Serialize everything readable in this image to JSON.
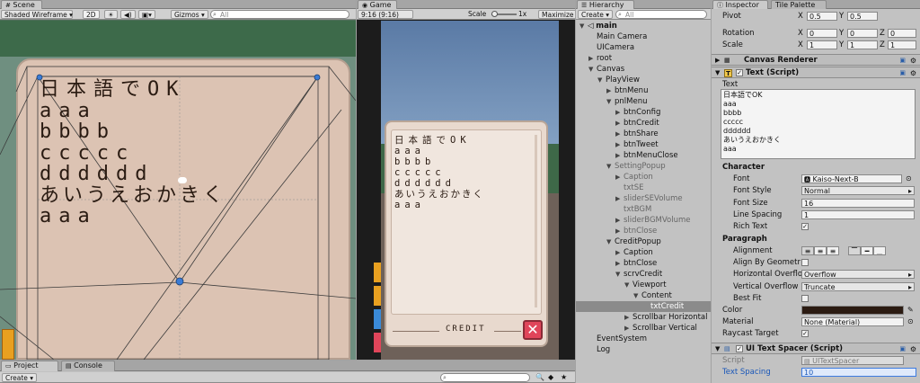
{
  "scene": {
    "tab": "Scene",
    "shading": "Shaded Wireframe",
    "mode_2d": "2D",
    "gizmos": "Gizmos",
    "search": "All",
    "text_lines": [
      "日本語でOK",
      "aaa",
      "bbbb",
      "ccccc",
      "dddddd",
      "あいうえおかきく",
      "aaa"
    ]
  },
  "game": {
    "tab": "Game",
    "resolution": "9:16 (9:16)",
    "scale_label": "Scale",
    "scale_value": "1x",
    "maximize": "Maximize",
    "popup_lines": [
      "日本語でOK",
      "aaa",
      "bbbb",
      "ccccc",
      "dddddd",
      "あいうえおかきく",
      "aaa"
    ],
    "credit_label": "CREDIT"
  },
  "hierarchy": {
    "tab": "Hierarchy",
    "create": "Create",
    "search": "All",
    "items": [
      {
        "label": "main",
        "expanded": true,
        "depth": 0,
        "scene": true
      },
      {
        "label": "Main Camera",
        "depth": 1
      },
      {
        "label": "UICamera",
        "depth": 1
      },
      {
        "label": "root",
        "depth": 1,
        "collapsed": true
      },
      {
        "label": "Canvas",
        "depth": 1,
        "expanded": true
      },
      {
        "label": "PlayView",
        "depth": 2,
        "expanded": true
      },
      {
        "label": "btnMenu",
        "depth": 3,
        "collapsed": true
      },
      {
        "label": "pnlMenu",
        "depth": 3,
        "expanded": true
      },
      {
        "label": "btnConfig",
        "depth": 4,
        "collapsed": true
      },
      {
        "label": "btnCredit",
        "depth": 4,
        "collapsed": true
      },
      {
        "label": "btnShare",
        "depth": 4,
        "collapsed": true
      },
      {
        "label": "btnTweet",
        "depth": 4,
        "collapsed": true
      },
      {
        "label": "btnMenuClose",
        "depth": 4,
        "collapsed": true
      },
      {
        "label": "SettingPopup",
        "depth": 3,
        "expanded": true,
        "dim": true
      },
      {
        "label": "Caption",
        "depth": 4,
        "collapsed": true,
        "dim": true
      },
      {
        "label": "txtSE",
        "depth": 4,
        "dim": true
      },
      {
        "label": "sliderSEVolume",
        "depth": 4,
        "collapsed": true,
        "dim": true
      },
      {
        "label": "txtBGM",
        "depth": 4,
        "dim": true
      },
      {
        "label": "sliderBGMVolume",
        "depth": 4,
        "collapsed": true,
        "dim": true
      },
      {
        "label": "btnClose",
        "depth": 4,
        "collapsed": true,
        "dim": true
      },
      {
        "label": "CreditPopup",
        "depth": 3,
        "expanded": true
      },
      {
        "label": "Caption",
        "depth": 4,
        "collapsed": true
      },
      {
        "label": "btnClose",
        "depth": 4,
        "collapsed": true
      },
      {
        "label": "scrvCredit",
        "depth": 4,
        "expanded": true
      },
      {
        "label": "Viewport",
        "depth": 5,
        "expanded": true
      },
      {
        "label": "Content",
        "depth": 6,
        "expanded": true
      },
      {
        "label": "txtCredit",
        "depth": 7,
        "selected": true
      },
      {
        "label": "Scrollbar Horizontal",
        "depth": 5,
        "collapsed": true
      },
      {
        "label": "Scrollbar Vertical",
        "depth": 5,
        "collapsed": true
      },
      {
        "label": "EventSystem",
        "depth": 1
      },
      {
        "label": "Log",
        "depth": 1
      }
    ]
  },
  "inspector": {
    "tab": "Inspector",
    "tab2": "Tile Palette",
    "pivot": {
      "label": "Pivot",
      "x": "0.5",
      "y": "0.5"
    },
    "rotation": {
      "label": "Rotation",
      "x": "0",
      "y": "0",
      "z": "0"
    },
    "scale": {
      "label": "Scale",
      "x": "1",
      "y": "1",
      "z": "1"
    },
    "canvas_renderer": "Canvas Renderer",
    "text_script": "Text (Script)",
    "text_label": "Text",
    "text_value": [
      "日本語でOK",
      "aaa",
      "bbbb",
      "ccccc",
      "dddddd",
      "あいうえおかきく",
      "aaa"
    ],
    "character": "Character",
    "font_label": "Font",
    "font_value": "Kaiso-Next-B",
    "font_style_label": "Font Style",
    "font_style_value": "Normal",
    "font_size_label": "Font Size",
    "font_size_value": "16",
    "line_spacing_label": "Line Spacing",
    "line_spacing_value": "1",
    "rich_text_label": "Rich Text",
    "paragraph": "Paragraph",
    "alignment_label": "Alignment",
    "align_geometry_label": "Align By Geometr",
    "h_overflow_label": "Horizontal Overflo",
    "h_overflow_value": "Overflow",
    "v_overflow_label": "Vertical Overflow",
    "v_overflow_value": "Truncate",
    "best_fit_label": "Best Fit",
    "color_label": "Color",
    "material_label": "Material",
    "material_value": "None (Material)",
    "raycast_label": "Raycast Target",
    "spacer_script": "UI Text Spacer (Script)",
    "script_label": "Script",
    "script_value": "UITextSpacer",
    "text_spacing_label": "Text Spacing",
    "text_spacing_value": "10",
    "color_swatch": "#2b1b12"
  },
  "bottom": {
    "project_tab": "Project",
    "console_tab": "Console",
    "create": "Create"
  },
  "colors": {
    "panel_bg": "#c2c2c2",
    "scene_paper": "#dcc3b3",
    "game_bg": "#1c1c1c",
    "popup_bg": "#e8d9ce",
    "close_red": "#e0455a"
  }
}
